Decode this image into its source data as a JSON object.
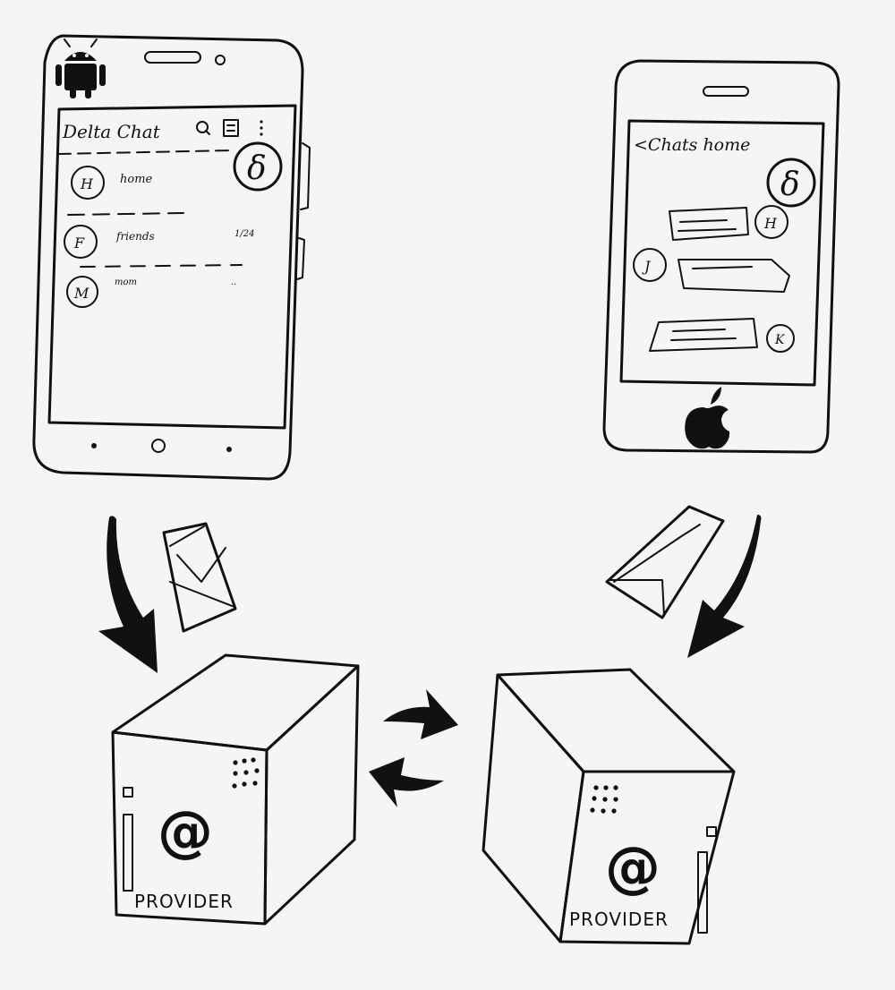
{
  "android_phone": {
    "app_title": "Delta Chat",
    "chats": [
      {
        "avatar": "H",
        "name": "home",
        "time": ""
      },
      {
        "avatar": "F",
        "name": "friends",
        "time": "1/24"
      },
      {
        "avatar": "M",
        "name": "mom",
        "time": ".."
      }
    ],
    "fab_symbol": "δ"
  },
  "iphone": {
    "header": "<Chats home",
    "fab_symbol": "δ",
    "message_avatars": [
      "H",
      "J",
      "K"
    ]
  },
  "providers": {
    "left": {
      "symbol": "@",
      "label": "PROVIDER"
    },
    "right": {
      "symbol": "@",
      "label": "PROVIDER"
    }
  }
}
